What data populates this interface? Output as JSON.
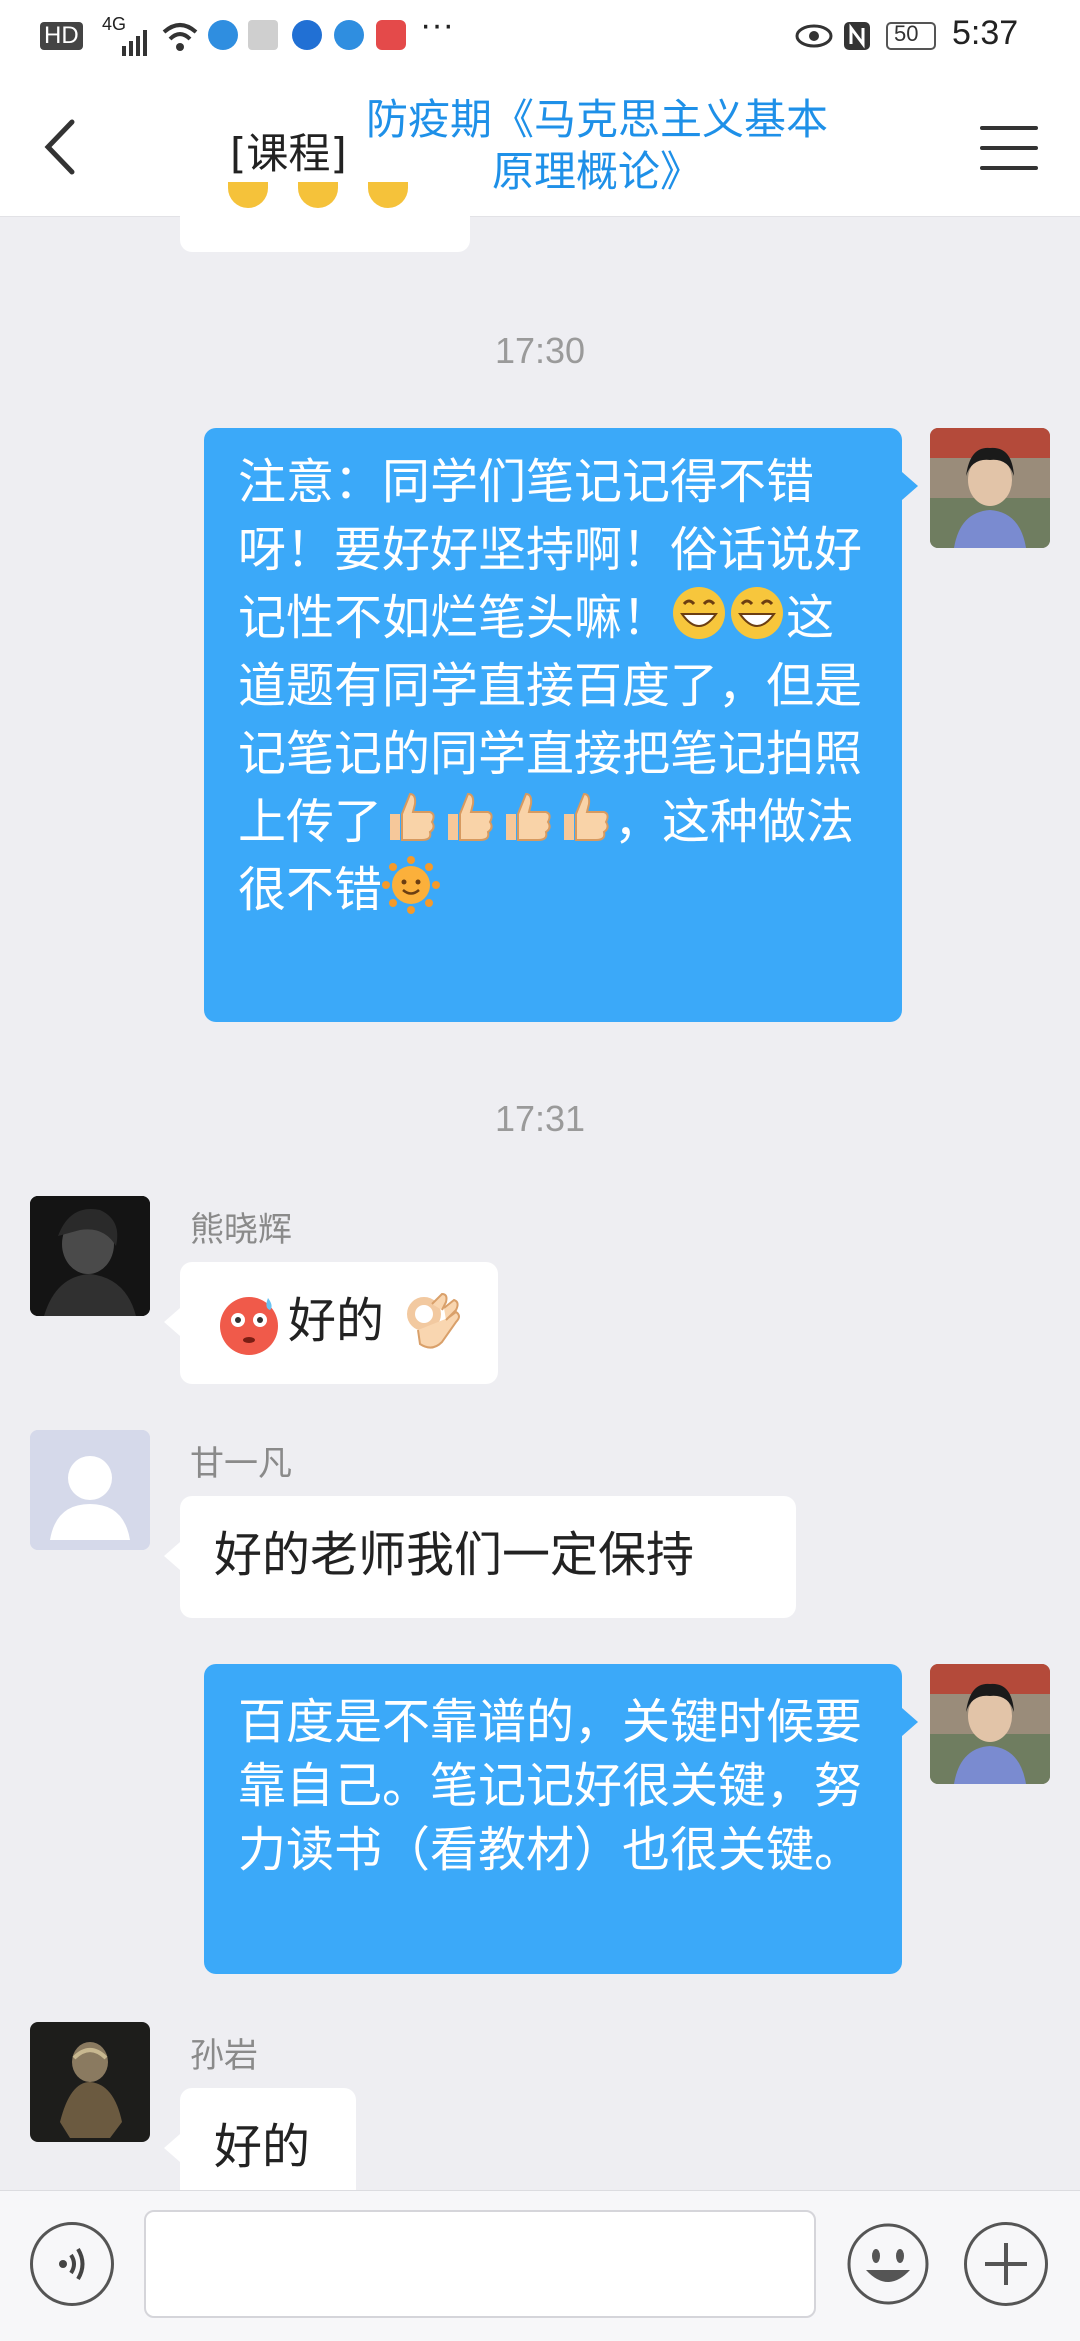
{
  "status_bar": {
    "hd": "HD",
    "network": "4G",
    "battery": "50",
    "time": "5:37"
  },
  "header": {
    "tag": "[课程]",
    "title": "防疫期《马克思主义基本原理概论》"
  },
  "messages": [
    {
      "type": "time",
      "text": "17:30"
    },
    {
      "type": "out",
      "parts": [
        "注意：同学们笔记记得不错呀！要好好坚持啊！俗话说好记性不如烂笔头嘛！",
        "这道题有同学直接百度了，但是记笔记的同学直接把笔记拍照上传了",
        "，这种做法很不错"
      ]
    },
    {
      "type": "time",
      "text": "17:31"
    },
    {
      "type": "in",
      "sender": "熊晓辉",
      "text": "好的"
    },
    {
      "type": "in",
      "sender": "甘一凡",
      "text": "好的老师我们一定保持"
    },
    {
      "type": "out",
      "text": "百度是不靠谱的，关键时候要靠自己。笔记记好很关键，努力读书（看教材）也很关键。"
    },
    {
      "type": "in",
      "sender": "孙岩",
      "text": "好的"
    }
  ],
  "icons": {
    "back": "chevron-left-icon",
    "menu": "hamburger-menu-icon",
    "voice": "voice-icon",
    "emoji": "emoji-icon",
    "plus": "plus-icon"
  },
  "colors": {
    "accent": "#1e90e8",
    "bubble_out": "#3ba9f9",
    "bubble_in": "#ffffff",
    "background": "#eeeef2"
  }
}
